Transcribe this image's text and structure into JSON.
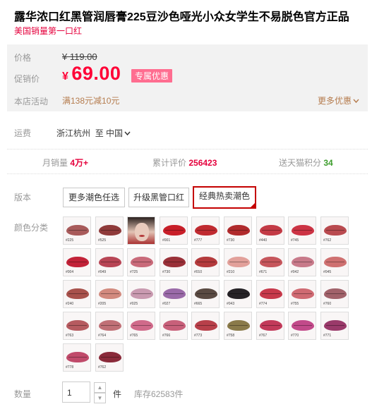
{
  "product": {
    "title": "露华浓口红黑管润唇膏225豆沙色哑光小众女学生不易脱色官方正品",
    "subtitle": "美国销量第一口红"
  },
  "price": {
    "label_price": "价格",
    "original": "¥ 119.00",
    "label_promo": "促销价",
    "promo_yen": "¥",
    "promo_value": "69.00",
    "badge": "专属优惠",
    "label_activity": "本店活动",
    "activity": "满138元减10元",
    "more": "更多优惠"
  },
  "shipping": {
    "label": "运费",
    "from": "浙江杭州",
    "to": "至 中国"
  },
  "stats": {
    "monthly_label": "月销量",
    "monthly_value": "4万+",
    "reviews_label": "累计评价",
    "reviews_value": "256423",
    "points_label": "送天猫积分",
    "points_value": "34"
  },
  "version": {
    "label": "版本",
    "options": [
      "更多潮色任选",
      "升级黑管口红",
      "经典热卖潮色"
    ],
    "selected": "经典热卖潮色"
  },
  "colors": {
    "label": "颜色分类",
    "swatches": [
      {
        "code": "#225",
        "color": "#a85a5a"
      },
      {
        "code": "#525",
        "color": "#8f3a3a"
      },
      {
        "code": "",
        "color": "#b53a3a",
        "portrait": true
      },
      {
        "code": "#001",
        "color": "#c81e28"
      },
      {
        "code": "#777",
        "color": "#c02a30"
      },
      {
        "code": "#730",
        "color": "#b02a2c"
      },
      {
        "code": "#440",
        "color": "#c33a45"
      },
      {
        "code": "#745",
        "color": "#cc3344"
      },
      {
        "code": "#762",
        "color": "#b94a4f"
      },
      {
        "code": "#004",
        "color": "#c22238"
      },
      {
        "code": "#049",
        "color": "#b84555"
      },
      {
        "code": "#725",
        "color": "#c96a7a"
      },
      {
        "code": "#730",
        "color": "#9a3038"
      },
      {
        "code": "#010",
        "color": "#b43a3c"
      },
      {
        "code": "#210",
        "color": "#e2a09a"
      },
      {
        "code": "#671",
        "color": "#c6565c"
      },
      {
        "code": "#042",
        "color": "#c87a8a"
      },
      {
        "code": "#045",
        "color": "#cf7070"
      },
      {
        "code": "#240",
        "color": "#a8524c"
      },
      {
        "code": "#205",
        "color": "#d28a7e"
      },
      {
        "code": "#025",
        "color": "#c99ab0"
      },
      {
        "code": "#027",
        "color": "#9a6aa8"
      },
      {
        "code": "#665",
        "color": "#5a4a42"
      },
      {
        "code": "#043",
        "color": "#262226"
      },
      {
        "code": "#774",
        "color": "#c7394b"
      },
      {
        "code": "#755",
        "color": "#cf6a72"
      },
      {
        "code": "#760",
        "color": "#a1626a"
      },
      {
        "code": "#763",
        "color": "#b65b60"
      },
      {
        "code": "#764",
        "color": "#c07076"
      },
      {
        "code": "#765",
        "color": "#d06a8a"
      },
      {
        "code": "#766",
        "color": "#c8607a"
      },
      {
        "code": "#773",
        "color": "#b8404a"
      },
      {
        "code": "#758",
        "color": "#8a7a4a"
      },
      {
        "code": "#767",
        "color": "#c23a5a"
      },
      {
        "code": "#770",
        "color": "#c24a8a"
      },
      {
        "code": "#771",
        "color": "#9a3a6a"
      },
      {
        "code": "#778",
        "color": "#c04a6a"
      },
      {
        "code": "#762",
        "color": "#8a2a3a"
      }
    ]
  },
  "quantity": {
    "label": "数量",
    "value": "1",
    "up": "▲",
    "down": "▼",
    "unit": "件",
    "stock": "库存62583件"
  }
}
